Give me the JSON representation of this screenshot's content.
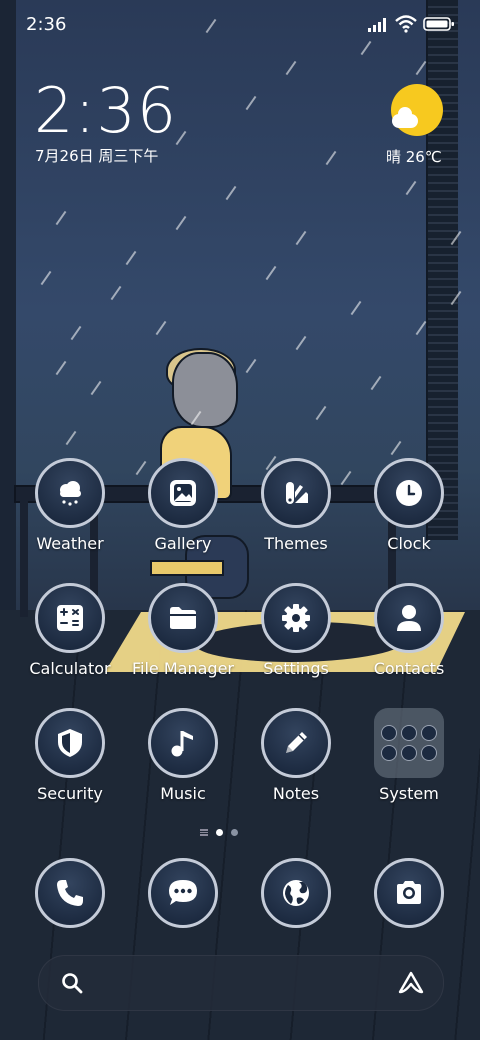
{
  "status": {
    "time": "2:36"
  },
  "lockscreen": {
    "clock": "2:36",
    "date": "7月26日 周三下午",
    "weather": "晴 26℃"
  },
  "apps": [
    {
      "label": "Weather",
      "icon": "weather-icon"
    },
    {
      "label": "Gallery",
      "icon": "gallery-icon"
    },
    {
      "label": "Themes",
      "icon": "themes-icon"
    },
    {
      "label": "Clock",
      "icon": "clock-icon"
    },
    {
      "label": "Calculator",
      "icon": "calculator-icon"
    },
    {
      "label": "File Manager",
      "icon": "folder-icon"
    },
    {
      "label": "Settings",
      "icon": "gear-icon"
    },
    {
      "label": "Contacts",
      "icon": "contact-icon"
    },
    {
      "label": "Security",
      "icon": "shield-icon"
    },
    {
      "label": "Music",
      "icon": "music-note-icon"
    },
    {
      "label": "Notes",
      "icon": "pencil-icon"
    },
    {
      "label": "System",
      "icon": "folder-grid-icon"
    }
  ],
  "dock": [
    {
      "icon": "phone-icon"
    },
    {
      "icon": "message-icon"
    },
    {
      "icon": "browser-globe-icon"
    },
    {
      "icon": "camera-icon"
    }
  ],
  "pager": {
    "active_index": 1,
    "count": 2
  },
  "colors": {
    "sun": "#f7c91f",
    "icon_border": "#c4cbd8"
  }
}
